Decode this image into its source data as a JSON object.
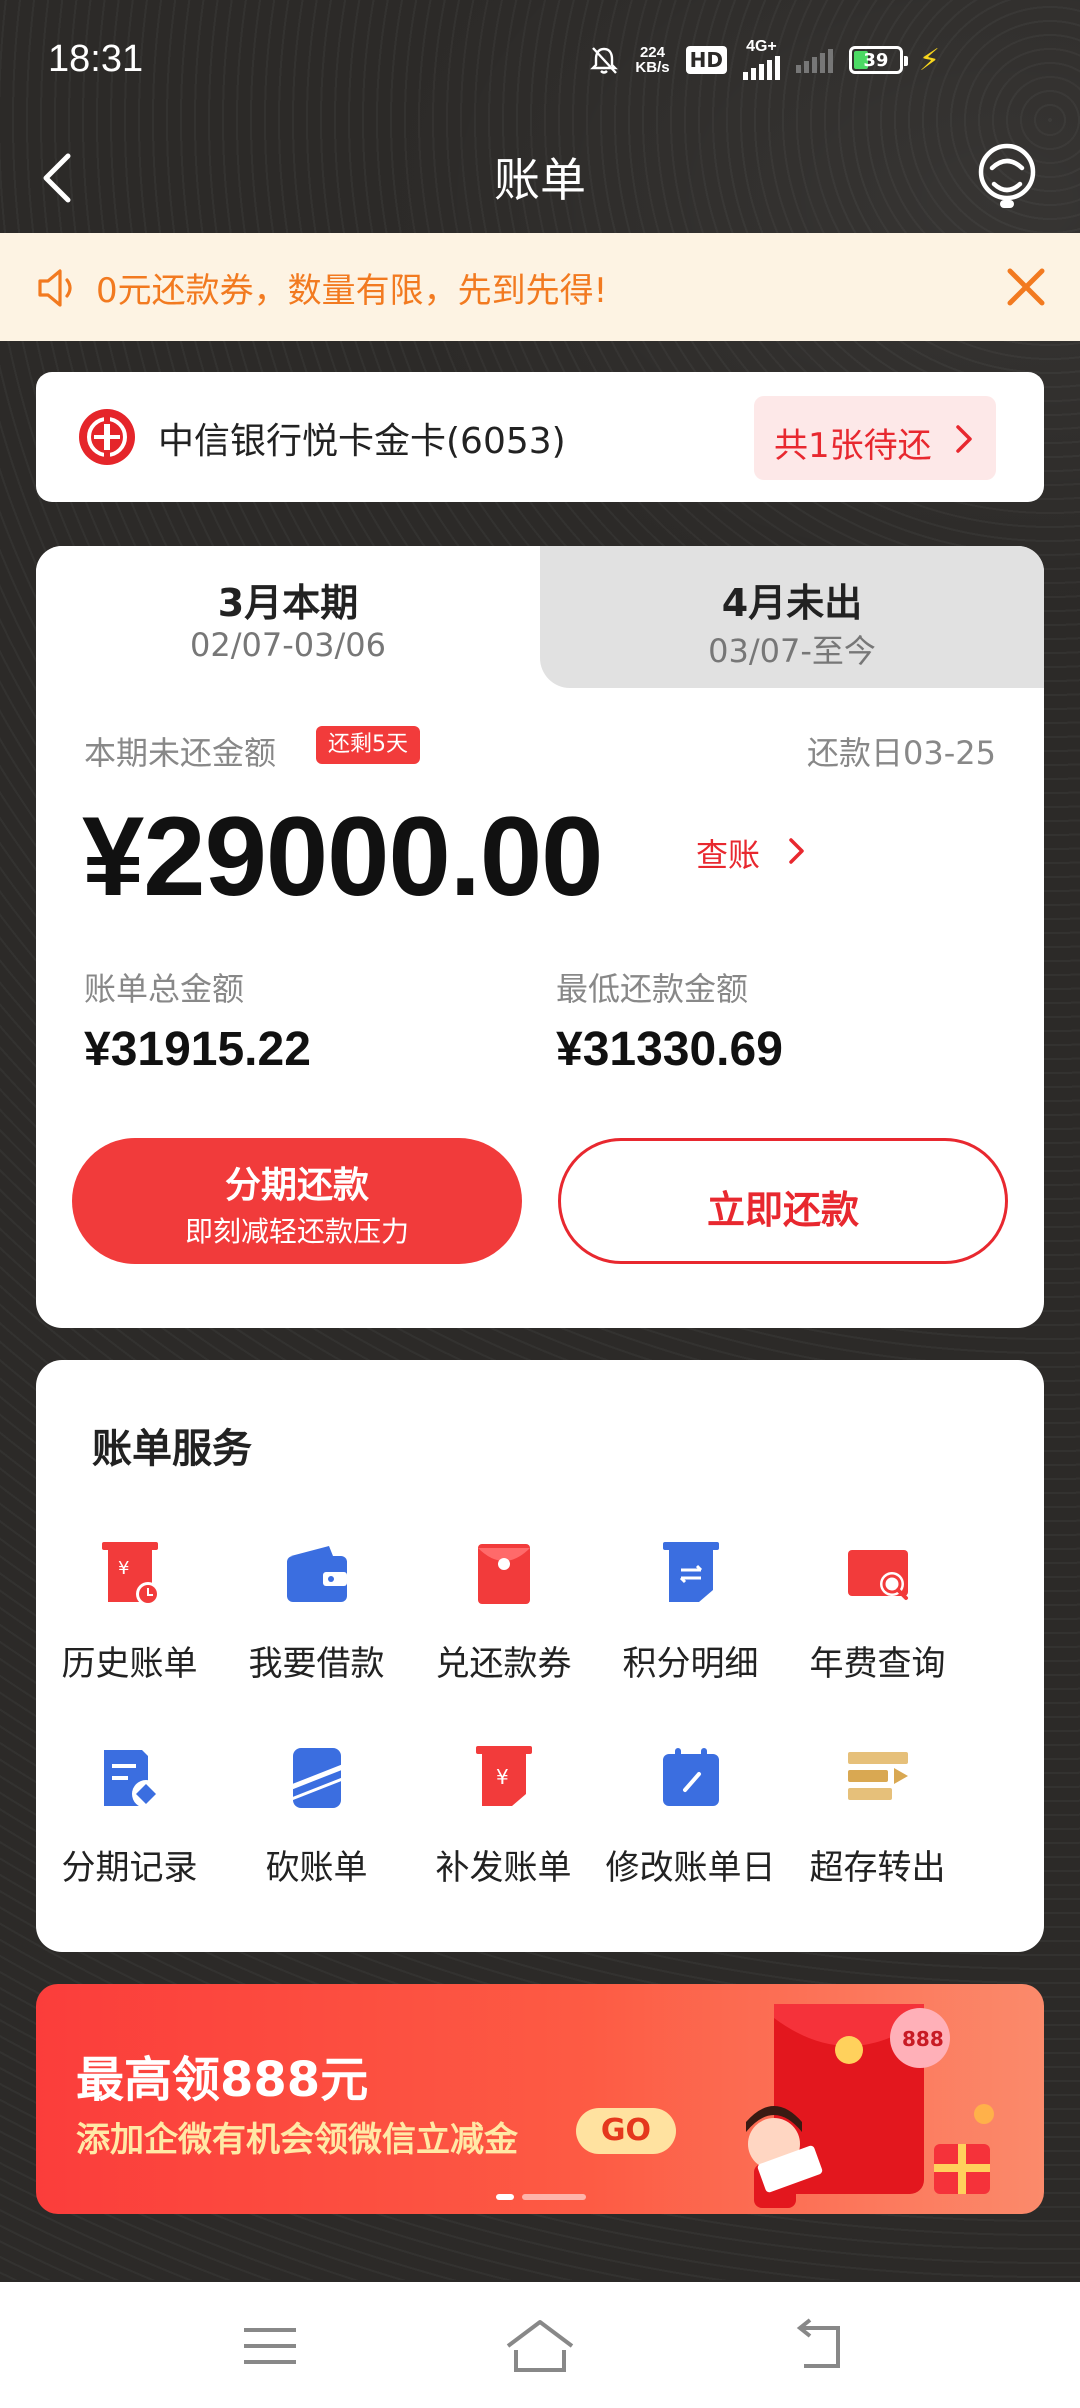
{
  "status_bar": {
    "time": "18:31",
    "net_speed_value": "224",
    "net_speed_unit": "KB/s",
    "hd_label": "HD",
    "network": "4G+",
    "battery": "39"
  },
  "header": {
    "title": "账单"
  },
  "notice": {
    "text": "0元还款券，数量有限，先到先得!"
  },
  "card": {
    "name": "中信银行悦卡金卡(6053)",
    "pending_label": "共1张待还"
  },
  "bill": {
    "tabs": [
      {
        "month": "3月本期",
        "range": "02/07-03/06"
      },
      {
        "month": "4月未出",
        "range": "03/07-至今"
      }
    ],
    "unpaid_label": "本期未还金额",
    "days_left_badge": "还剩5天",
    "due_date": "还款日03-25",
    "unpaid_amount": "¥29000.00",
    "view_bill_label": "查账",
    "total_label": "账单总金额",
    "total_value": "¥31915.22",
    "min_label": "最低还款金额",
    "min_value": "¥31330.69",
    "installment_title": "分期还款",
    "installment_sub": "即刻减轻还款压力",
    "pay_now_label": "立即还款"
  },
  "services": {
    "title": "账单服务",
    "items": [
      {
        "label": "历史账单",
        "icon": "history-bill-icon"
      },
      {
        "label": "我要借款",
        "icon": "wallet-icon"
      },
      {
        "label": "兑还款券",
        "icon": "red-envelope-icon"
      },
      {
        "label": "积分明细",
        "icon": "points-icon"
      },
      {
        "label": "年费查询",
        "icon": "fee-search-icon"
      },
      {
        "label": "分期记录",
        "icon": "installment-record-icon"
      },
      {
        "label": "砍账单",
        "icon": "cut-bill-icon"
      },
      {
        "label": "补发账单",
        "icon": "reissue-bill-icon"
      },
      {
        "label": "修改账单日",
        "icon": "calendar-edit-icon"
      },
      {
        "label": "超存转出",
        "icon": "transfer-out-icon"
      }
    ]
  },
  "banner": {
    "title": "最高领888元",
    "subtitle": "添加企微有机会领微信立减金",
    "go_label": "GO",
    "coin_label": "888"
  },
  "colors": {
    "accent_red": "#e8282f",
    "notice_orange": "#f27a20",
    "icon_blue": "#3b6ee0"
  }
}
